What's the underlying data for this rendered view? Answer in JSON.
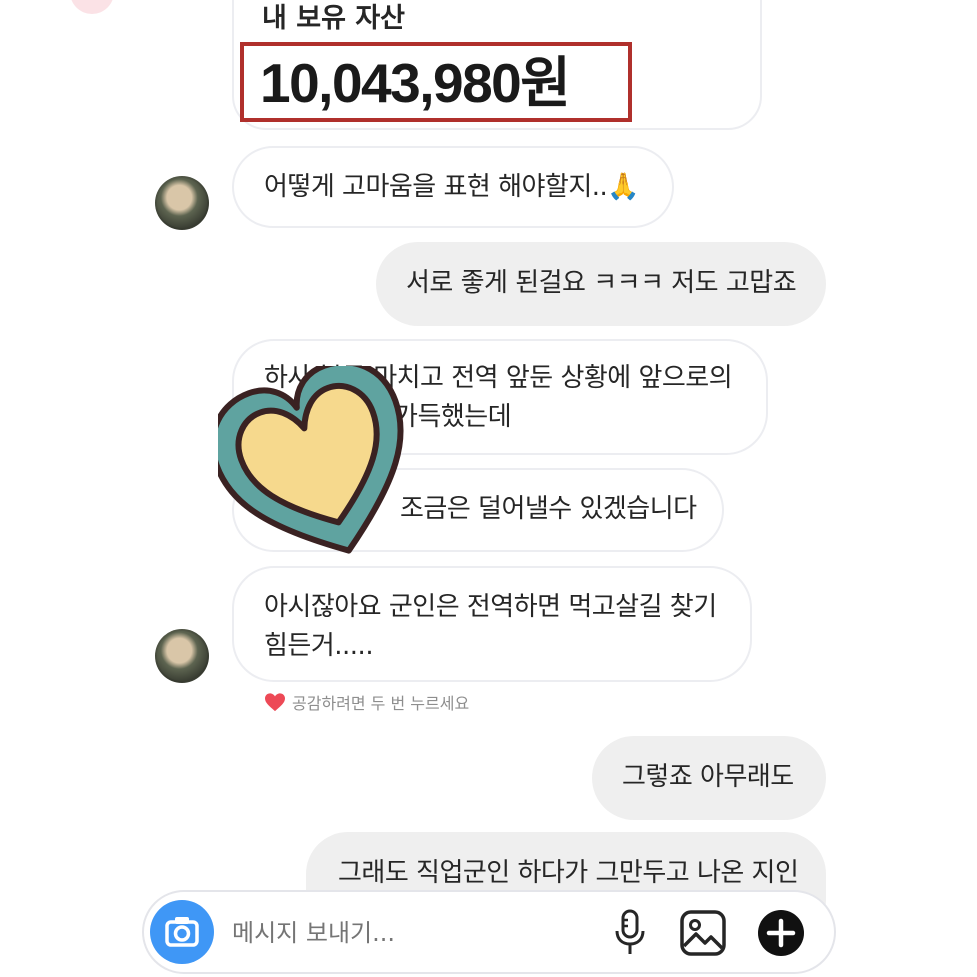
{
  "asset_card": {
    "label": "내 보유 자산",
    "amount": "10,043,980원"
  },
  "messages": [
    {
      "side": "received",
      "text": "어떻게 고마움을 표현 해야할지..🙏"
    },
    {
      "side": "sent",
      "text": "서로 좋게 된걸요 ㅋㅋㅋ 저도 고맙죠"
    },
    {
      "side": "received",
      "line1": "하사 복무 마치고 전역 앞둔 상황에 앞으로의",
      "line2": "부담이 가득했는데"
    },
    {
      "side": "received",
      "text": "조금은 덜어낼수 있겠습니다"
    },
    {
      "side": "received",
      "line1": "아시잖아요 군인은 전역하면 먹고살길 찾기",
      "line2": "힘든거....."
    },
    {
      "side": "sent",
      "text": "그렇죠 아무래도"
    },
    {
      "side": "sent",
      "text": "그래도 직업군인 하다가 그만두고 나온 지인"
    }
  ],
  "like_hint": "공감하려면 두 번 누르세요",
  "composer": {
    "placeholder": "메시지 보내기..."
  },
  "icons": {
    "camera": "camera-icon",
    "mic": "microphone-icon",
    "gallery": "image-gallery-icon",
    "plus": "plus-icon",
    "heart": "heart-icon",
    "sticker": "heart-sticker-icon"
  },
  "colors": {
    "highlight_box": "#b0302c",
    "camera_button": "#3f97f6",
    "received_border": "#ecedf1",
    "sent_bubble": "#efefef",
    "heart": "#ed4956",
    "sticker_fill": "#f6d98d",
    "sticker_ring": "#5fa3a0",
    "sticker_outline": "#3a2222"
  }
}
